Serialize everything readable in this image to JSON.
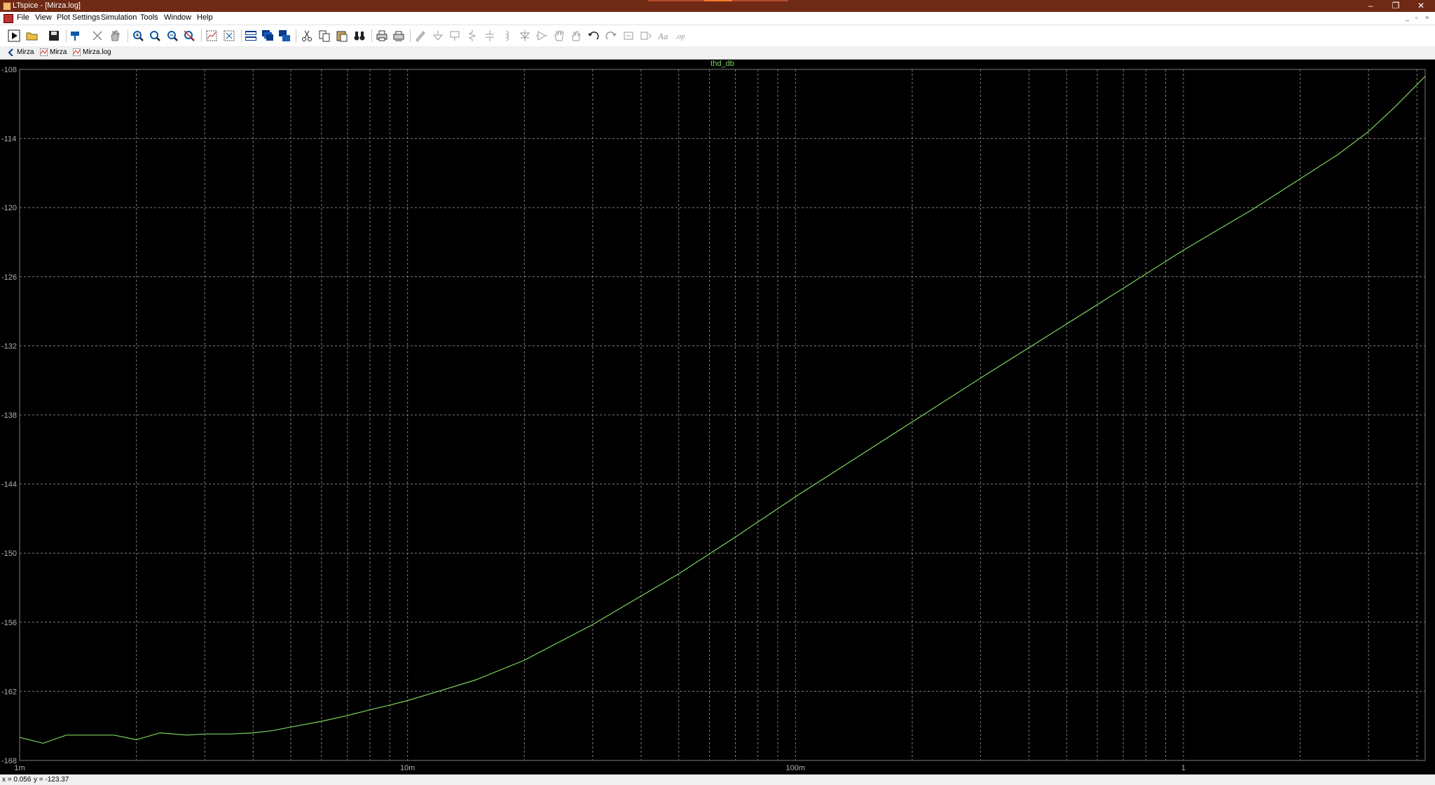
{
  "window": {
    "title": "LTspice - [Mirza.log]",
    "controls": {
      "minimize": "–",
      "restore": "❐",
      "close": "✕"
    }
  },
  "menu": {
    "items": [
      "File",
      "View",
      "Plot Settings",
      "Simulation",
      "Tools",
      "Window",
      "Help"
    ]
  },
  "toolbar": {
    "buttons": [
      "run",
      "open",
      "save",
      "control-panel",
      "halt",
      "pan-hand",
      "zoom-in",
      "zoom-area",
      "zoom-out",
      "zoom-fit",
      "autorange",
      "zoom-extents",
      "tile-horizontal",
      "cascade",
      "tile-vertical",
      "cut",
      "copy",
      "paste",
      "find",
      "print",
      "print-setup",
      "wire",
      "ground",
      "label",
      "resistor",
      "capacitor",
      "inductor",
      "diode",
      "component",
      "move",
      "drag",
      "undo",
      "redo",
      "rotate",
      "mirror",
      "text",
      "spice-directive"
    ]
  },
  "tabs": [
    {
      "label": "Mirza",
      "icon": "schematic-icon"
    },
    {
      "label": "Mirza",
      "icon": "waveform-icon"
    },
    {
      "label": "Mirza.log",
      "icon": "waveform-icon"
    }
  ],
  "plot": {
    "background": "#000000",
    "trace_color": "#7cd35a",
    "grid_color": "#7d7d7d"
  },
  "chart_data": {
    "type": "line",
    "title": "thd_db",
    "xscale": "log",
    "xlim": [
      0.001,
      4.2
    ],
    "ylim": [
      -168,
      -108
    ],
    "x_ticks": [
      {
        "value": 0.001,
        "label": "1m"
      },
      {
        "value": 0.01,
        "label": "10m"
      },
      {
        "value": 0.1,
        "label": "100m"
      },
      {
        "value": 1,
        "label": "1"
      }
    ],
    "y_ticks": [
      {
        "value": -108,
        "label": "-108"
      },
      {
        "value": -114,
        "label": "-114"
      },
      {
        "value": -120,
        "label": "-120"
      },
      {
        "value": -126,
        "label": "-126"
      },
      {
        "value": -132,
        "label": "-132"
      },
      {
        "value": -138,
        "label": "-138"
      },
      {
        "value": -144,
        "label": "-144"
      },
      {
        "value": -150,
        "label": "-150"
      },
      {
        "value": -156,
        "label": "-156"
      },
      {
        "value": -162,
        "label": "-162"
      },
      {
        "value": -168,
        "label": "-168"
      }
    ],
    "grid": true,
    "series": [
      {
        "name": "thd_db",
        "x": [
          0.001,
          0.00115,
          0.00132,
          0.0015,
          0.00175,
          0.002,
          0.0023,
          0.0027,
          0.003,
          0.0035,
          0.004,
          0.0045,
          0.005,
          0.006,
          0.007,
          0.008,
          0.009,
          0.01,
          0.012,
          0.015,
          0.02,
          0.03,
          0.05,
          0.07,
          0.1,
          0.15,
          0.2,
          0.3,
          0.5,
          0.7,
          1,
          1.5,
          2,
          2.5,
          3,
          3.5,
          4.2
        ],
        "y": [
          -166.0,
          -166.5,
          -165.8,
          -165.8,
          -165.8,
          -166.2,
          -165.6,
          -165.8,
          -165.7,
          -165.7,
          -165.6,
          -165.4,
          -165.1,
          -164.6,
          -164.1,
          -163.6,
          -163.2,
          -162.8,
          -162.0,
          -161.0,
          -159.3,
          -156.2,
          -151.8,
          -148.6,
          -145.1,
          -141.3,
          -138.6,
          -134.8,
          -130.1,
          -127.0,
          -123.7,
          -120.2,
          -117.5,
          -115.4,
          -113.4,
          -111.3,
          -108.6
        ]
      }
    ]
  },
  "status": {
    "x_readout": "x = 0.056",
    "y_readout": "y = -123.37"
  }
}
